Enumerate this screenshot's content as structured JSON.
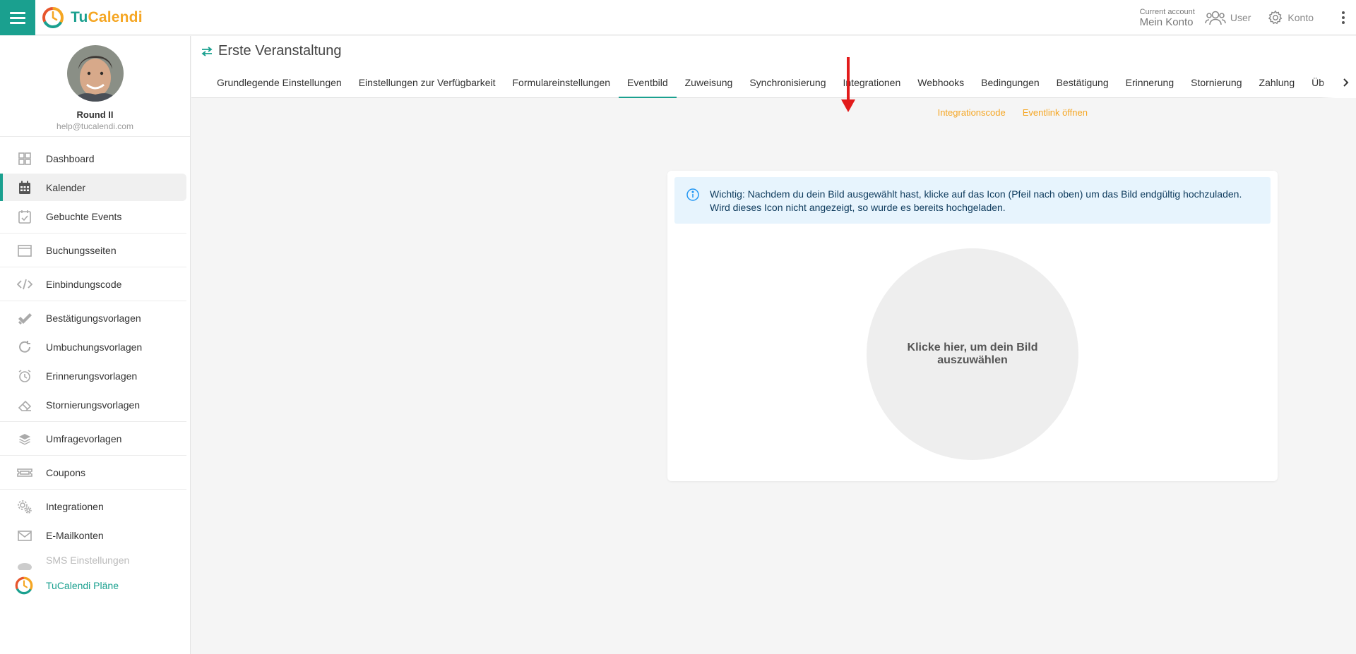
{
  "topbar": {
    "brand_tu": "Tu",
    "brand_cal": "Calendi",
    "account_caption": "Current account",
    "account_name": "Mein Konto",
    "user_label": "User",
    "konto_label": "Konto"
  },
  "profile": {
    "name": "Round II",
    "email": "help@tucalendi.com"
  },
  "sidebar": {
    "items": [
      {
        "label": "Dashboard",
        "icon": "grid-icon"
      },
      {
        "label": "Kalender",
        "icon": "calendar-icon"
      },
      {
        "label": "Gebuchte Events",
        "icon": "calendar-check-icon"
      },
      {
        "label": "Buchungsseiten",
        "icon": "browser-window-icon"
      },
      {
        "label": "Einbindungscode",
        "icon": "code-icon"
      },
      {
        "label": "Bestätigungsvorlagen",
        "icon": "double-check-icon"
      },
      {
        "label": "Umbuchungsvorlagen",
        "icon": "refresh-icon"
      },
      {
        "label": "Erinnerungsvorlagen",
        "icon": "alarm-clock-icon"
      },
      {
        "label": "Stornierungsvorlagen",
        "icon": "eraser-icon"
      },
      {
        "label": "Umfragevorlagen",
        "icon": "layers-icon"
      },
      {
        "label": "Coupons",
        "icon": "ticket-icon"
      },
      {
        "label": "Integrationen",
        "icon": "gears-icon"
      },
      {
        "label": "E-Mailkonten",
        "icon": "envelope-icon"
      },
      {
        "label": "SMS Einstellungen",
        "icon": "sms-icon"
      },
      {
        "label": "TuCalendi Pläne",
        "icon": "logo-icon"
      }
    ]
  },
  "event": {
    "title": "Erste Veranstaltung"
  },
  "tabs": [
    "Grundlegende Einstellungen",
    "Einstellungen zur Verfügbarkeit",
    "Formulareinstellungen",
    "Eventbild",
    "Zuweisung",
    "Synchronisierung",
    "Integrationen",
    "Webhooks",
    "Bedingungen",
    "Bestätigung",
    "Erinnerung",
    "Stornierung",
    "Zahlung",
    "Üb"
  ],
  "links": {
    "integration_code": "Integrationscode",
    "open_event_link": "Eventlink öffnen"
  },
  "alert": {
    "line1": "Wichtig: Nachdem du dein Bild ausgewählt hast, klicke auf das Icon (Pfeil nach oben) um das Bild endgültig hochzuladen.",
    "line2": "Wird dieses Icon nicht angezeigt, so wurde es bereits hochgeladen."
  },
  "uploader": {
    "text": "Klicke hier, um dein Bild auszuwählen"
  },
  "colors": {
    "accent": "#1aa08f",
    "brand_orange": "#f5a623",
    "annotation_arrow": "#e21b1b"
  }
}
